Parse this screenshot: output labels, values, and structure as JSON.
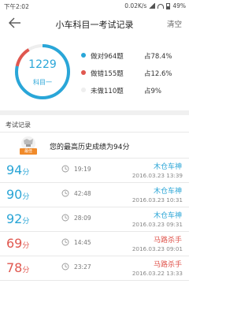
{
  "status_bar": {
    "time": "下午2:02",
    "network": "0.02K/s",
    "battery": "49%"
  },
  "header": {
    "title": "小车科目一考试记录",
    "clear_label": "清空"
  },
  "summary": {
    "total": "1229",
    "subject": "科目一",
    "correct_text": "做对964题",
    "correct_pct": "占78.4%",
    "correct_fraction": 0.784,
    "wrong_text": "做错155题",
    "wrong_pct": "占12.6%",
    "wrong_fraction": 0.126,
    "undone_text": "未做110题",
    "undone_pct": "占9%",
    "undone_fraction": 0.09,
    "colors": {
      "correct": "#29a6d8",
      "wrong": "#e0574f",
      "undone": "#eeeeee"
    }
  },
  "records_section": {
    "title": "考试记录",
    "best_tag": "最佳",
    "best_text": "您的最高历史成绩为94分"
  },
  "records": [
    {
      "score": "94",
      "unit": "分",
      "duration": "19:19",
      "grade": "木仓车神",
      "date": "2016.03.23  13:39",
      "status": "pass"
    },
    {
      "score": "90",
      "unit": "分",
      "duration": "42:48",
      "grade": "木仓车神",
      "date": "2016.03.23  10:31",
      "status": "pass"
    },
    {
      "score": "92",
      "unit": "分",
      "duration": "28:09",
      "grade": "木仓车神",
      "date": "2016.03.23  09:31",
      "status": "pass"
    },
    {
      "score": "69",
      "unit": "分",
      "duration": "14:45",
      "grade": "马路杀手",
      "date": "2016.03.23  09:01",
      "status": "fail"
    },
    {
      "score": "78",
      "unit": "分",
      "duration": "23:27",
      "grade": "马路杀手",
      "date": "2016.03.22  13:33",
      "status": "fail"
    },
    {
      "score": "",
      "unit": "",
      "duration": "",
      "grade": "",
      "date": "",
      "status": "fail"
    }
  ]
}
